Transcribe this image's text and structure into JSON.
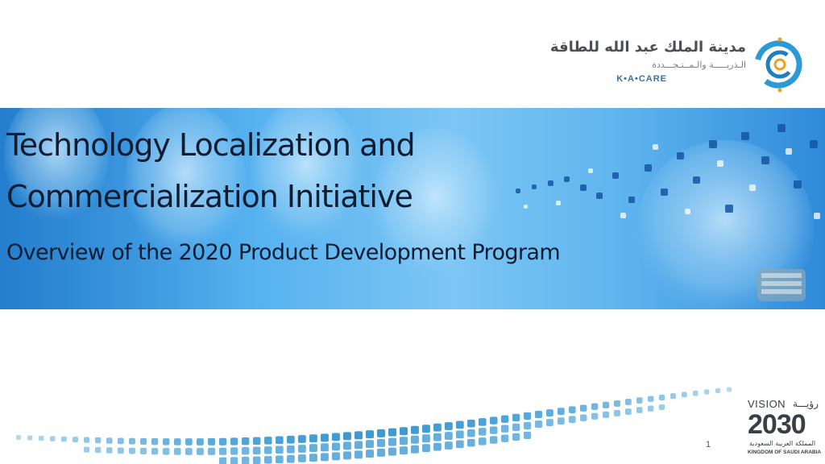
{
  "logo": {
    "arabic_name": "مدينة الملك عبد الله للطاقة",
    "arabic_sub": "الـذريـــــة والـمــتـجـــددة",
    "english": "K•A•CARE",
    "colors": {
      "ring": "#2b9ad6",
      "accent": "#f0a020",
      "text": "#4a5056"
    }
  },
  "banner": {
    "title_line1": "Technology Localization and",
    "title_line2": "Commercialization Initiative",
    "subtitle": "Overview of the 2020 Product Development Program",
    "colors": {
      "sky": "#5fb5ee",
      "deep": "#2b8fe0",
      "text": "#0c1d33"
    }
  },
  "footer": {
    "page_number": "1",
    "vision": {
      "label": "VISION",
      "label_ar": "رؤيـــة",
      "year": "2030",
      "kingdom_ar": "المملكة العربية السعودية",
      "kingdom_en": "KINGDOM OF SAUDI ARABIA"
    },
    "decor_color": "#2a8fcf"
  }
}
